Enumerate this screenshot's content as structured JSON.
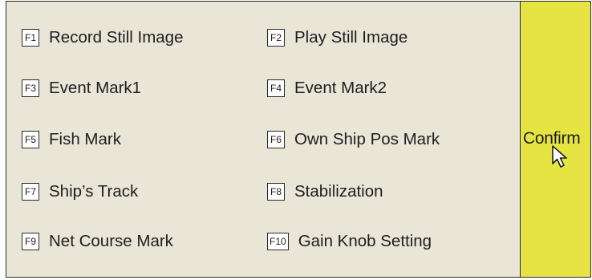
{
  "function_menu": {
    "items": [
      {
        "key": "F1",
        "label": "Record Still Image"
      },
      {
        "key": "F2",
        "label": "Play Still Image"
      },
      {
        "key": "F3",
        "label": "Event Mark1"
      },
      {
        "key": "F4",
        "label": "Event Mark2"
      },
      {
        "key": "F5",
        "label": "Fish Mark"
      },
      {
        "key": "F6",
        "label": "Own Ship Pos Mark"
      },
      {
        "key": "F7",
        "label": "Ship’s Track"
      },
      {
        "key": "F8",
        "label": "Stabilization"
      },
      {
        "key": "F9",
        "label": "Net Course Mark"
      },
      {
        "key": "F10",
        "label": "Gain Knob Setting"
      }
    ]
  },
  "confirm_panel": {
    "label": "Confirm",
    "color": "#e6e443",
    "cursor_icon": "arrow-pointer-icon"
  },
  "colors": {
    "menu_background": "#e9e5d7",
    "border": "#2a2a2a",
    "text": "#1e1e1e"
  }
}
